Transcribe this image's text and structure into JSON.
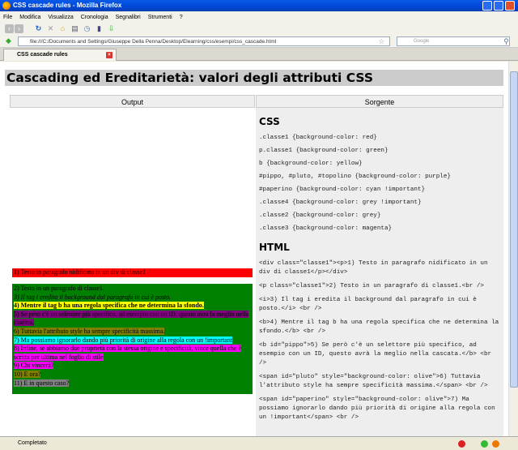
{
  "window": {
    "title": "CSS cascade rules - Mozilla Firefox"
  },
  "menu": [
    "File",
    "Modifica",
    "Visualizza",
    "Cronologia",
    "Segnalibri",
    "Strumenti",
    "?"
  ],
  "url": "file:///C:/Documents and Settings/Giuseppe Della Penna/Desktop/Elearning/css/esempi/css_cascade.html",
  "search_placeholder": "Google",
  "tab": {
    "label": "CSS cascade rules"
  },
  "page": {
    "heading": "Cascading ed Ereditarietà: valori degli attributi CSS",
    "col_output": "Output",
    "col_source": "Sorgente",
    "output": {
      "p1": "1) Testo in paragrafo nidificato in un div di classe1",
      "l2": "2) Testo in un paragrafo di classe1.",
      "l3": "3) Il tag i eredita il background dal paragrafo in cui è posto.",
      "l4": "4) Mentre il tag b ha una regola specifica che ne determina la sfondo.",
      "l5": "5) Se però c'è un selettore più specifico, ad esempio con un ID, questo avrà la meglio nella cascata.",
      "l6": "6) Tuttavia l'attributo style ha sempre specificità massima.",
      "l7": "7) Ma possiamo ignorarlo dando più priorità di origine alla regola con un !important",
      "l8": "8) Infine, se abbiamo due proprietà con la stessa origine e specificità, vince quella che è scritta per ultima nel foglio di stile",
      "l9": "9) Chi vincerà?",
      "l10": "10) E ora?",
      "l11": "11) E in questo caso?"
    },
    "css_title": "CSS",
    "css": [
      ".classe1 {background-color: red}",
      "p.classe1 {background-color: green}",
      "b {background-color: yellow}",
      "#pippo, #pluto, #topolino {background-color: purple}",
      "#paperino {background-color: cyan !important}",
      ".classe4 {background-color: grey !important}",
      ".classe2 {background-color: grey}",
      ".classe3 {background-color: magenta}"
    ],
    "html_title": "HTML",
    "html": [
      "<div class=\"classe1\"><p>1) Testo in paragrafo nidificato in un div di classe1</p></div>",
      "<p class=\"classe1\">2) Testo in un paragrafo di classe1.<br />",
      "<i>3) Il tag i eredita il background dal paragrafo in cui è posto.</i> <br />",
      "<b>4) Mentre il tag b ha una regola specifica che ne determina la sfondo.</b> <br />",
      "<b id=\"pippo\">5) Se però c'è un selettore più specifico, ad esempio con un ID, questo avrà la meglio nella cascata.</b> <br />",
      "<span id=\"pluto\" style=\"background-color: olive\">6) Tuttavia l'attributo style ha sempre specificità massima.</span> <br />",
      "<span id=\"paperino\" style=\"background-color: olive\">7) Ma possiamo ignorarlo dando più priorità di origine alla regola con un !important</span> <br />"
    ]
  },
  "status": "Completato"
}
